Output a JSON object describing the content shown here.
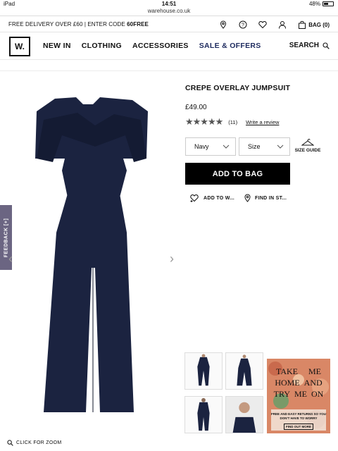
{
  "status_bar": {
    "device": "iPad",
    "time": "14:51",
    "battery": "48%",
    "battery_level": 0.48
  },
  "browser": {
    "url": "warehouse.co.uk"
  },
  "promo_bar": {
    "message_prefix": "FREE DELIVERY OVER £60 | ENTER CODE ",
    "message_code": "60FREE",
    "bag_label": "BAG (0)"
  },
  "nav": {
    "logo": "W.",
    "links": [
      "NEW IN",
      "CLOTHING",
      "ACCESSORIES",
      "SALE & OFFERS"
    ],
    "search_label": "SEARCH"
  },
  "feedback": {
    "label": "FEEDBACK",
    "sign": "[+]"
  },
  "product": {
    "title": "CREPE OVERLAY JUMPSUIT",
    "price": "£49.00",
    "rating_stars": 4.5,
    "review_count": "(11)",
    "write_review": "Write a review",
    "colour_select": "Navy",
    "size_select": "Size",
    "size_guide": "SIZE GUIDE",
    "add_to_bag": "ADD TO BAG",
    "add_to_wishlist": "ADD TO W...",
    "find_in_store": "FIND IN ST...",
    "click_for_zoom": "CLICK FOR ZOOM"
  },
  "promo_tile": {
    "words": [
      "TAKE",
      "ME",
      "HOME",
      "AND",
      "TRY",
      "ME",
      "ON"
    ],
    "subtext": "FREE AND EASY RETURNS SO YOU DON'T HAVE TO WORRY",
    "button": "FIND OUT MORE"
  },
  "colors": {
    "navy": "#1b2340",
    "sale": "#1d2a5e",
    "feedback": "#6b6582",
    "promo_tile": "#d98766"
  }
}
